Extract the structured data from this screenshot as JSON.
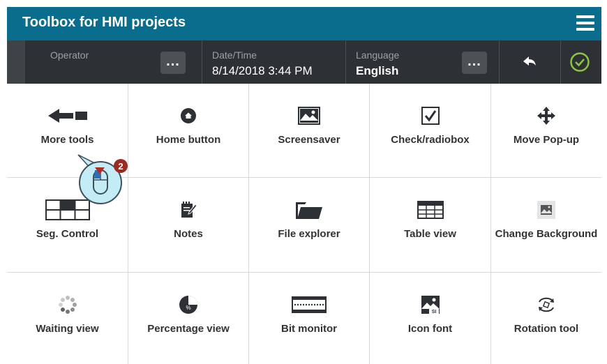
{
  "header": {
    "title": "Toolbox for HMI projects",
    "menu_icon": "hamburger-menu-icon",
    "color": "#0b6d8e"
  },
  "statusbar": {
    "operator_label": "Operator",
    "operator_value": "",
    "datetime_label": "Date/Time",
    "datetime_value": "8/14/2018 3:44 PM",
    "language_label": "Language",
    "language_value": "English",
    "more_label": "...",
    "back_icon": "back-arrow-icon",
    "ok_icon": "checkmark-circle-icon",
    "ok_color": "#8cc63f"
  },
  "tools": [
    {
      "label": "More tools",
      "icon": "arrow-left-icon"
    },
    {
      "label": "Home button",
      "icon": "home-icon"
    },
    {
      "label": "Screensaver",
      "icon": "image-icon"
    },
    {
      "label": "Check/radiobox",
      "icon": "checkbox-icon"
    },
    {
      "label": "Move Pop-up",
      "icon": "move-arrows-icon"
    },
    {
      "label": "Seg. Control",
      "icon": "segmented-control-icon"
    },
    {
      "label": "Notes",
      "icon": "notes-icon"
    },
    {
      "label": "File explorer",
      "icon": "folder-icon"
    },
    {
      "label": "Table view",
      "icon": "table-icon"
    },
    {
      "label": "Change Background",
      "icon": "background-image-icon"
    },
    {
      "label": "Waiting view",
      "icon": "spinner-icon"
    },
    {
      "label": "Percentage view",
      "icon": "percent-pie-icon"
    },
    {
      "label": "Bit monitor",
      "icon": "bit-monitor-icon"
    },
    {
      "label": "Icon font",
      "icon": "icon-font-icon"
    },
    {
      "label": "Rotation tool",
      "icon": "rotation-icon"
    }
  ],
  "cursor": {
    "badge": "2",
    "icon": "mouse-click-icon"
  }
}
